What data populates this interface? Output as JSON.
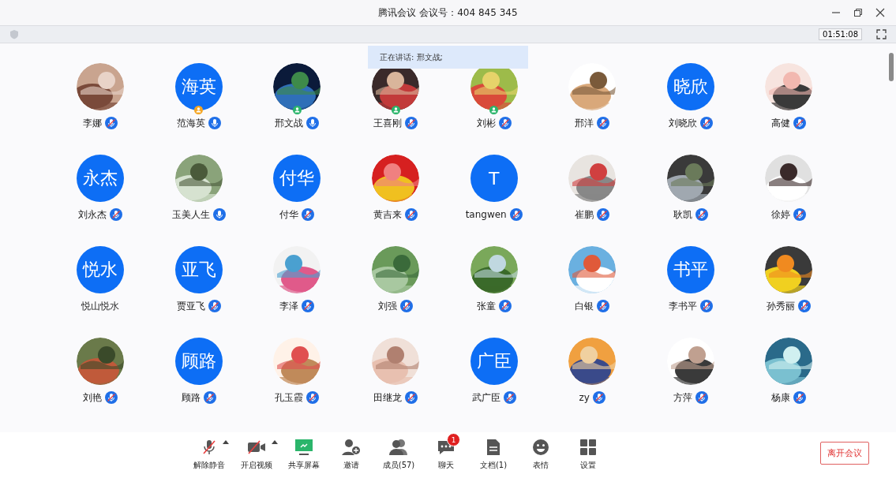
{
  "window": {
    "title": "腾讯会议 会议号：404 845 345"
  },
  "timer": "01:51:08",
  "speaking": "正在讲话: 邢文战;",
  "participants": [
    {
      "name": "李娜",
      "kind": "picture",
      "muted": true
    },
    {
      "name": "范海英",
      "kind": "text",
      "avatar_text": "海英",
      "muted": false,
      "color": "#f5a623"
    },
    {
      "name": "邢文战",
      "kind": "picture",
      "muted": false,
      "color": "#2bb56b"
    },
    {
      "name": "王喜刚",
      "kind": "picture",
      "muted": true,
      "color": "#2bb56b"
    },
    {
      "name": "刘彬",
      "kind": "picture",
      "muted": true,
      "color": "#2bb56b"
    },
    {
      "name": "邢洋",
      "kind": "picture",
      "muted": true
    },
    {
      "name": "刘晓欣",
      "kind": "text",
      "avatar_text": "晓欣",
      "muted": true
    },
    {
      "name": "高健",
      "kind": "picture",
      "muted": true
    },
    {
      "name": "刘永杰",
      "kind": "text",
      "avatar_text": "永杰",
      "muted": true
    },
    {
      "name": "玉美人生",
      "kind": "picture",
      "muted": false
    },
    {
      "name": "付华",
      "kind": "text",
      "avatar_text": "付华",
      "muted": true
    },
    {
      "name": "黄吉来",
      "kind": "picture",
      "muted": true
    },
    {
      "name": "tangwen",
      "kind": "text",
      "avatar_text": "T",
      "muted": true
    },
    {
      "name": "崔鹏",
      "kind": "picture",
      "muted": true
    },
    {
      "name": "耿凯",
      "kind": "picture",
      "muted": true
    },
    {
      "name": "徐婷",
      "kind": "picture",
      "muted": true
    },
    {
      "name": "悦山悦水",
      "kind": "text",
      "avatar_text": "悦水"
    },
    {
      "name": "贾亚飞",
      "kind": "text",
      "avatar_text": "亚飞",
      "muted": true
    },
    {
      "name": "李泽",
      "kind": "picture",
      "muted": true
    },
    {
      "name": "刘强",
      "kind": "picture",
      "muted": true
    },
    {
      "name": "张童",
      "kind": "picture",
      "muted": true
    },
    {
      "name": "白银",
      "kind": "picture",
      "muted": true
    },
    {
      "name": "李书平",
      "kind": "text",
      "avatar_text": "书平",
      "muted": true
    },
    {
      "name": "孙秀丽",
      "kind": "picture",
      "muted": true
    },
    {
      "name": "刘艳",
      "kind": "picture",
      "muted": true
    },
    {
      "name": "顾路",
      "kind": "text",
      "avatar_text": "顾路",
      "muted": true
    },
    {
      "name": "孔玉霞",
      "kind": "picture",
      "muted": true
    },
    {
      "name": "田继龙",
      "kind": "picture",
      "muted": true
    },
    {
      "name": "武广臣",
      "kind": "text",
      "avatar_text": "广臣",
      "muted": true
    },
    {
      "name": "zy",
      "kind": "picture",
      "muted": true
    },
    {
      "name": "方萍",
      "kind": "picture",
      "muted": true
    },
    {
      "name": "杨康",
      "kind": "picture",
      "muted": true
    }
  ],
  "toolbar": [
    {
      "kind": "mic",
      "label": "解除静音",
      "caret": true
    },
    {
      "kind": "video",
      "label": "开启视频",
      "caret": true
    },
    {
      "kind": "share",
      "label": "共享屏幕"
    },
    {
      "kind": "invite",
      "label": "邀请"
    },
    {
      "kind": "members",
      "label": "成员(57)"
    },
    {
      "kind": "chat",
      "label": "聊天",
      "badge": "1"
    },
    {
      "kind": "docs",
      "label": "文档(1)"
    },
    {
      "kind": "emoji",
      "label": "表情"
    },
    {
      "kind": "settings",
      "label": "设置"
    }
  ],
  "leave_button": "离开会议"
}
